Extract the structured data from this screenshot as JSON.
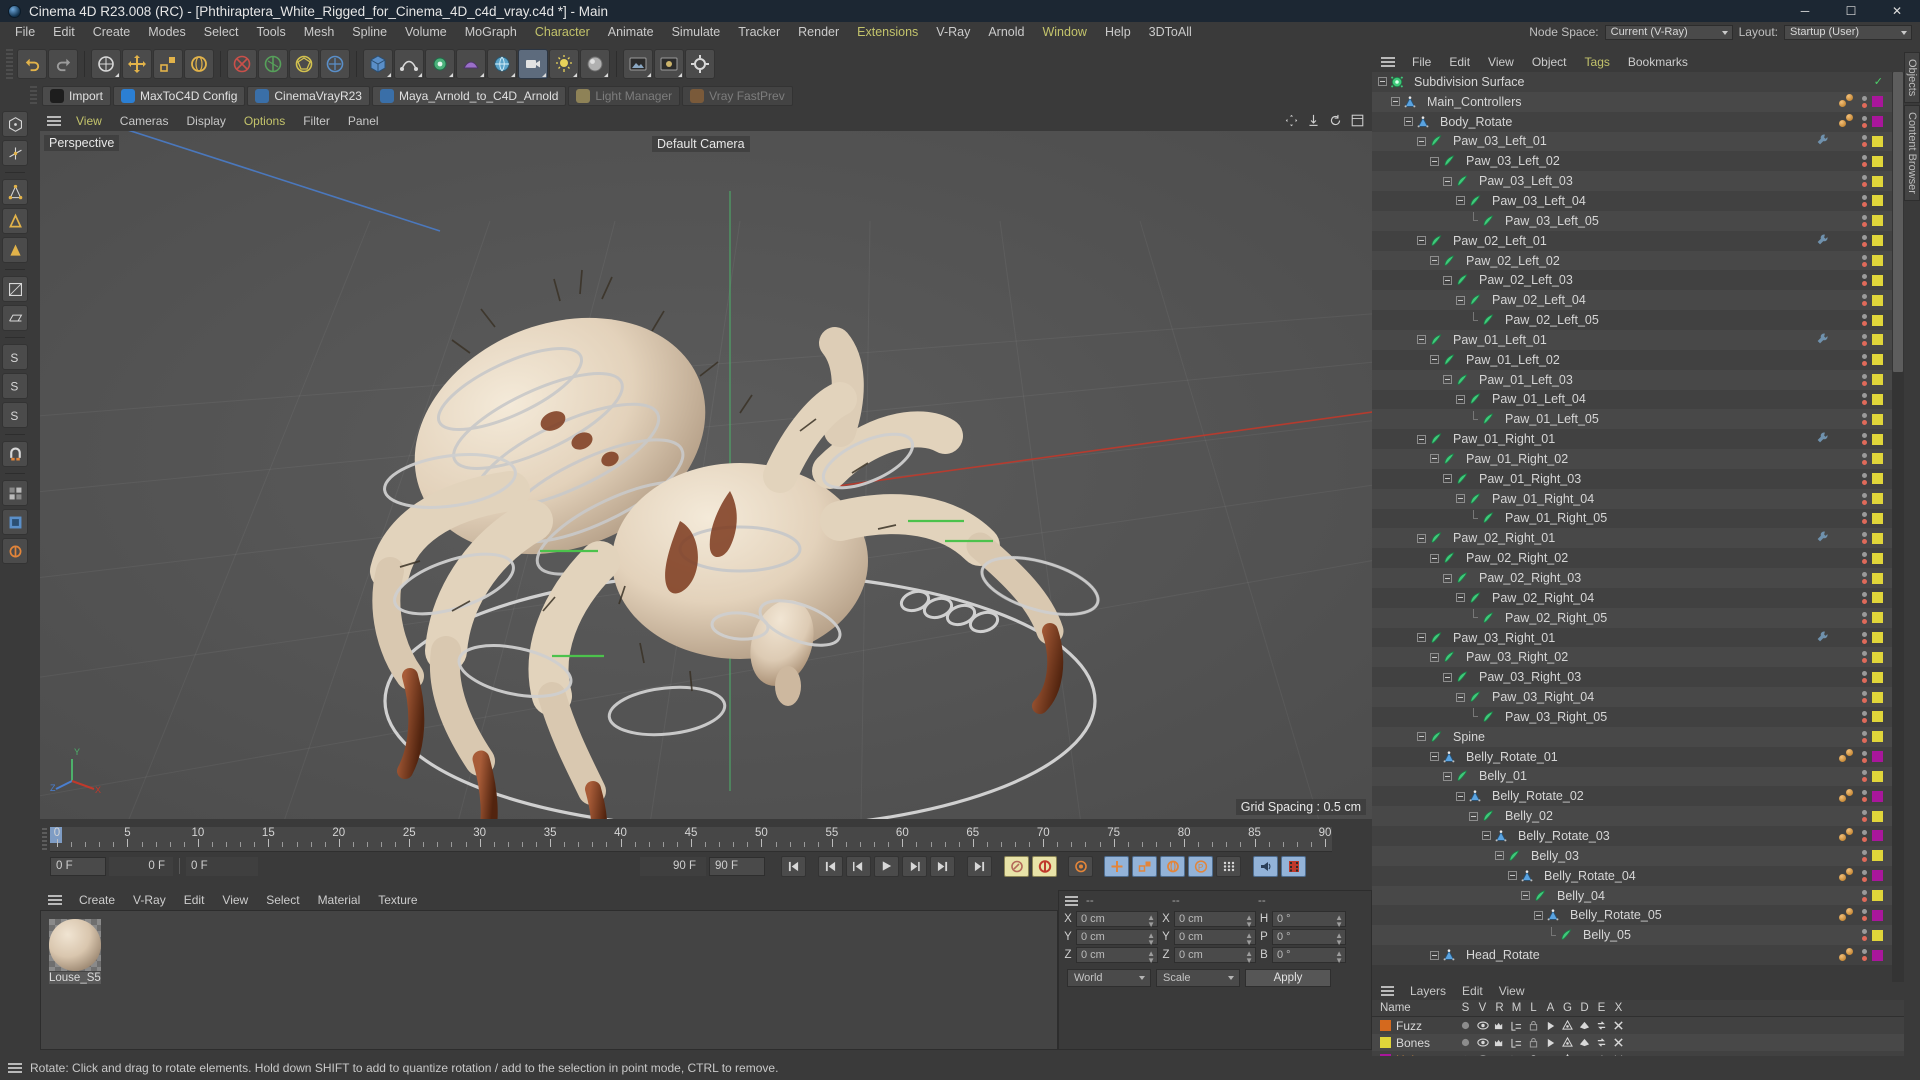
{
  "window": {
    "title": "Cinema 4D R23.008 (RC) - [Phthiraptera_White_Rigged_for_Cinema_4D_c4d_vray.c4d *] - Main",
    "minimize": "─",
    "maximize": "☐",
    "close": "✕"
  },
  "menubar": {
    "items": [
      {
        "label": "File",
        "accent": false
      },
      {
        "label": "Edit",
        "accent": false
      },
      {
        "label": "Create",
        "accent": false
      },
      {
        "label": "Modes",
        "accent": false
      },
      {
        "label": "Select",
        "accent": false
      },
      {
        "label": "Tools",
        "accent": false
      },
      {
        "label": "Mesh",
        "accent": false
      },
      {
        "label": "Spline",
        "accent": false
      },
      {
        "label": "Volume",
        "accent": false
      },
      {
        "label": "MoGraph",
        "accent": false
      },
      {
        "label": "Character",
        "accent": true
      },
      {
        "label": "Animate",
        "accent": false
      },
      {
        "label": "Simulate",
        "accent": false
      },
      {
        "label": "Tracker",
        "accent": false
      },
      {
        "label": "Render",
        "accent": false
      },
      {
        "label": "Extensions",
        "accent": true
      },
      {
        "label": "V-Ray",
        "accent": false
      },
      {
        "label": "Arnold",
        "accent": false
      },
      {
        "label": "Window",
        "accent": true
      },
      {
        "label": "Help",
        "accent": false
      },
      {
        "label": "3DToAll",
        "accent": false
      }
    ],
    "node_space_label": "Node Space:",
    "node_space_value": "Current (V-Ray)",
    "layout_label": "Layout:",
    "layout_value": "Startup (User)"
  },
  "pluginbar": {
    "items": [
      {
        "label": "Import",
        "color": "#1d1d1d",
        "disabled": false
      },
      {
        "label": "MaxToC4D Config",
        "color": "#2b7fd4",
        "disabled": false
      },
      {
        "label": "CinemaVrayR23",
        "color": "#3a6fa8",
        "disabled": false
      },
      {
        "label": "Maya_Arnold_to_C4D_Arnold",
        "color": "#3a6fa8",
        "disabled": false
      },
      {
        "label": "Light Manager",
        "color": "#8e8257",
        "disabled": true
      },
      {
        "label": "Vray FastPrev",
        "color": "#7a5a3a",
        "disabled": true
      }
    ]
  },
  "viewport": {
    "menu": [
      {
        "label": "View",
        "accent": true
      },
      {
        "label": "Cameras",
        "accent": false
      },
      {
        "label": "Display",
        "accent": false
      },
      {
        "label": "Options",
        "accent": true
      },
      {
        "label": "Filter",
        "accent": false
      },
      {
        "label": "Panel",
        "accent": false
      }
    ],
    "corner_label": "Perspective",
    "camera_label": "Default Camera",
    "grid_spacing": "Grid Spacing : 0.5 cm",
    "axis_x": "X",
    "axis_y": "Y",
    "axis_z": "Z"
  },
  "timeline": {
    "ticks": [
      0,
      5,
      10,
      15,
      20,
      25,
      30,
      35,
      40,
      45,
      50,
      55,
      60,
      65,
      70,
      75,
      80,
      85,
      90
    ],
    "min_frame": "0 F",
    "current_frame": "0 F",
    "max_frame": "90 F",
    "preview_end": "90 F",
    "end_frame": "90 F",
    "playhead_frame": 0
  },
  "material_manager": {
    "menu": [
      "Create",
      "V-Ray",
      "Edit",
      "View",
      "Select",
      "Material",
      "Texture"
    ],
    "materials": [
      {
        "name": "Louse_S5"
      }
    ]
  },
  "coordinates": {
    "header": [
      "--",
      "--",
      "--"
    ],
    "rows": [
      {
        "l1": "X",
        "v1": "0 cm",
        "l2": "X",
        "v2": "0 cm",
        "l3": "H",
        "v3": "0 °"
      },
      {
        "l1": "Y",
        "v1": "0 cm",
        "l2": "Y",
        "v2": "0 cm",
        "l3": "P",
        "v3": "0 °"
      },
      {
        "l1": "Z",
        "v1": "0 cm",
        "l2": "Z",
        "v2": "0 cm",
        "l3": "B",
        "v3": "0 °"
      }
    ],
    "space_select": "World",
    "mode_select": "Scale",
    "apply_button": "Apply"
  },
  "object_manager": {
    "menu": [
      {
        "label": "File",
        "accent": false
      },
      {
        "label": "Edit",
        "accent": false
      },
      {
        "label": "View",
        "accent": false
      },
      {
        "label": "Object",
        "accent": false
      },
      {
        "label": "Tags",
        "accent": true
      },
      {
        "label": "Bookmarks",
        "accent": false
      }
    ],
    "objects": [
      {
        "name": "Subdivision Surface",
        "depth": 0,
        "icon": "subdivision",
        "expand": "open",
        "tag": "none",
        "dots": false,
        "nulltags": false,
        "extra": "check"
      },
      {
        "name": "Main_Controllers",
        "depth": 1,
        "icon": "null",
        "expand": "open",
        "tag": "#a9169b",
        "dots": true,
        "nulltags": true
      },
      {
        "name": "Body_Rotate",
        "depth": 2,
        "icon": "null",
        "expand": "open",
        "tag": "#a9169b",
        "dots": true,
        "nulltags": true
      },
      {
        "name": "Paw_03_Left_01",
        "depth": 3,
        "icon": "joint",
        "expand": "open",
        "tag": "#e0d53a",
        "dots": true,
        "nulltags": false,
        "wrench": true
      },
      {
        "name": "Paw_03_Left_02",
        "depth": 4,
        "icon": "joint",
        "expand": "open",
        "tag": "#e0d53a",
        "dots": true,
        "nulltags": false
      },
      {
        "name": "Paw_03_Left_03",
        "depth": 5,
        "icon": "joint",
        "expand": "open",
        "tag": "#e0d53a",
        "dots": true,
        "nulltags": false
      },
      {
        "name": "Paw_03_Left_04",
        "depth": 6,
        "icon": "joint",
        "expand": "open",
        "tag": "#e0d53a",
        "dots": true,
        "nulltags": false
      },
      {
        "name": "Paw_03_Left_05",
        "depth": 7,
        "icon": "joint",
        "expand": "leaf",
        "tag": "#e0d53a",
        "dots": true,
        "nulltags": false
      },
      {
        "name": "Paw_02_Left_01",
        "depth": 3,
        "icon": "joint",
        "expand": "open",
        "tag": "#e0d53a",
        "dots": true,
        "nulltags": false,
        "wrench": true
      },
      {
        "name": "Paw_02_Left_02",
        "depth": 4,
        "icon": "joint",
        "expand": "open",
        "tag": "#e0d53a",
        "dots": true,
        "nulltags": false
      },
      {
        "name": "Paw_02_Left_03",
        "depth": 5,
        "icon": "joint",
        "expand": "open",
        "tag": "#e0d53a",
        "dots": true,
        "nulltags": false
      },
      {
        "name": "Paw_02_Left_04",
        "depth": 6,
        "icon": "joint",
        "expand": "open",
        "tag": "#e0d53a",
        "dots": true,
        "nulltags": false
      },
      {
        "name": "Paw_02_Left_05",
        "depth": 7,
        "icon": "joint",
        "expand": "leaf",
        "tag": "#e0d53a",
        "dots": true,
        "nulltags": false
      },
      {
        "name": "Paw_01_Left_01",
        "depth": 3,
        "icon": "joint",
        "expand": "open",
        "tag": "#e0d53a",
        "dots": true,
        "nulltags": false,
        "wrench": true
      },
      {
        "name": "Paw_01_Left_02",
        "depth": 4,
        "icon": "joint",
        "expand": "open",
        "tag": "#e0d53a",
        "dots": true,
        "nulltags": false
      },
      {
        "name": "Paw_01_Left_03",
        "depth": 5,
        "icon": "joint",
        "expand": "open",
        "tag": "#e0d53a",
        "dots": true,
        "nulltags": false
      },
      {
        "name": "Paw_01_Left_04",
        "depth": 6,
        "icon": "joint",
        "expand": "open",
        "tag": "#e0d53a",
        "dots": true,
        "nulltags": false
      },
      {
        "name": "Paw_01_Left_05",
        "depth": 7,
        "icon": "joint",
        "expand": "leaf",
        "tag": "#e0d53a",
        "dots": true,
        "nulltags": false
      },
      {
        "name": "Paw_01_Right_01",
        "depth": 3,
        "icon": "joint",
        "expand": "open",
        "tag": "#e0d53a",
        "dots": true,
        "nulltags": false,
        "wrench": true
      },
      {
        "name": "Paw_01_Right_02",
        "depth": 4,
        "icon": "joint",
        "expand": "open",
        "tag": "#e0d53a",
        "dots": true,
        "nulltags": false
      },
      {
        "name": "Paw_01_Right_03",
        "depth": 5,
        "icon": "joint",
        "expand": "open",
        "tag": "#e0d53a",
        "dots": true,
        "nulltags": false
      },
      {
        "name": "Paw_01_Right_04",
        "depth": 6,
        "icon": "joint",
        "expand": "open",
        "tag": "#e0d53a",
        "dots": true,
        "nulltags": false
      },
      {
        "name": "Paw_01_Right_05",
        "depth": 7,
        "icon": "joint",
        "expand": "leaf",
        "tag": "#e0d53a",
        "dots": true,
        "nulltags": false
      },
      {
        "name": "Paw_02_Right_01",
        "depth": 3,
        "icon": "joint",
        "expand": "open",
        "tag": "#e0d53a",
        "dots": true,
        "nulltags": false,
        "wrench": true
      },
      {
        "name": "Paw_02_Right_02",
        "depth": 4,
        "icon": "joint",
        "expand": "open",
        "tag": "#e0d53a",
        "dots": true,
        "nulltags": false
      },
      {
        "name": "Paw_02_Right_03",
        "depth": 5,
        "icon": "joint",
        "expand": "open",
        "tag": "#e0d53a",
        "dots": true,
        "nulltags": false
      },
      {
        "name": "Paw_02_Right_04",
        "depth": 6,
        "icon": "joint",
        "expand": "open",
        "tag": "#e0d53a",
        "dots": true,
        "nulltags": false
      },
      {
        "name": "Paw_02_Right_05",
        "depth": 7,
        "icon": "joint",
        "expand": "leaf",
        "tag": "#e0d53a",
        "dots": true,
        "nulltags": false
      },
      {
        "name": "Paw_03_Right_01",
        "depth": 3,
        "icon": "joint",
        "expand": "open",
        "tag": "#e0d53a",
        "dots": true,
        "nulltags": false,
        "wrench": true
      },
      {
        "name": "Paw_03_Right_02",
        "depth": 4,
        "icon": "joint",
        "expand": "open",
        "tag": "#e0d53a",
        "dots": true,
        "nulltags": false
      },
      {
        "name": "Paw_03_Right_03",
        "depth": 5,
        "icon": "joint",
        "expand": "open",
        "tag": "#e0d53a",
        "dots": true,
        "nulltags": false
      },
      {
        "name": "Paw_03_Right_04",
        "depth": 6,
        "icon": "joint",
        "expand": "open",
        "tag": "#e0d53a",
        "dots": true,
        "nulltags": false
      },
      {
        "name": "Paw_03_Right_05",
        "depth": 7,
        "icon": "joint",
        "expand": "leaf",
        "tag": "#e0d53a",
        "dots": true,
        "nulltags": false
      },
      {
        "name": "Spine",
        "depth": 3,
        "icon": "joint",
        "expand": "open",
        "tag": "#e0d53a",
        "dots": true,
        "nulltags": false
      },
      {
        "name": "Belly_Rotate_01",
        "depth": 4,
        "icon": "null",
        "expand": "open",
        "tag": "#a9169b",
        "dots": true,
        "nulltags": true
      },
      {
        "name": "Belly_01",
        "depth": 5,
        "icon": "joint",
        "expand": "open",
        "tag": "#e0d53a",
        "dots": true,
        "nulltags": false
      },
      {
        "name": "Belly_Rotate_02",
        "depth": 6,
        "icon": "null",
        "expand": "open",
        "tag": "#a9169b",
        "dots": true,
        "nulltags": true
      },
      {
        "name": "Belly_02",
        "depth": 7,
        "icon": "joint",
        "expand": "open",
        "tag": "#e0d53a",
        "dots": true,
        "nulltags": false
      },
      {
        "name": "Belly_Rotate_03",
        "depth": 8,
        "icon": "null",
        "expand": "open",
        "tag": "#a9169b",
        "dots": true,
        "nulltags": true
      },
      {
        "name": "Belly_03",
        "depth": 9,
        "icon": "joint",
        "expand": "open",
        "tag": "#e0d53a",
        "dots": true,
        "nulltags": false
      },
      {
        "name": "Belly_Rotate_04",
        "depth": 10,
        "icon": "null",
        "expand": "open",
        "tag": "#a9169b",
        "dots": true,
        "nulltags": true
      },
      {
        "name": "Belly_04",
        "depth": 11,
        "icon": "joint",
        "expand": "open",
        "tag": "#e0d53a",
        "dots": true,
        "nulltags": false
      },
      {
        "name": "Belly_Rotate_05",
        "depth": 12,
        "icon": "null",
        "expand": "open",
        "tag": "#a9169b",
        "dots": true,
        "nulltags": true
      },
      {
        "name": "Belly_05",
        "depth": 13,
        "icon": "joint",
        "expand": "leaf",
        "tag": "#e0d53a",
        "dots": true,
        "nulltags": false
      },
      {
        "name": "Head_Rotate",
        "depth": 4,
        "icon": "null",
        "expand": "open",
        "tag": "#a9169b",
        "dots": true,
        "nulltags": true
      }
    ]
  },
  "layer_manager": {
    "menu": [
      "Layers",
      "Edit",
      "View"
    ],
    "columns": [
      "Name",
      "S",
      "V",
      "R",
      "M",
      "L",
      "A",
      "G",
      "D",
      "E",
      "X"
    ],
    "layers": [
      {
        "name": "Fuzz",
        "color": "#d4691e",
        "highlight": false
      },
      {
        "name": "Bones",
        "color": "#e0d53a",
        "highlight": false
      },
      {
        "name": "Helpers",
        "color": "#a9169b",
        "highlight": true
      }
    ]
  },
  "right_dock": {
    "tabs": [
      "Objects",
      "Content Browser"
    ]
  },
  "statusbar": {
    "text": "Rotate: Click and drag to rotate elements. Hold down SHIFT to add to quantize rotation / add to the selection in point mode, CTRL to remove."
  },
  "colors": {
    "panel_bg": "#3a3a3a",
    "viewport_bg": "#545454",
    "accent_yellow": "#c3c36b",
    "tag_yellow": "#e0d53a",
    "tag_magenta": "#a9169b",
    "layer_orange": "#d4691e",
    "title_bg": "#1c2733"
  }
}
